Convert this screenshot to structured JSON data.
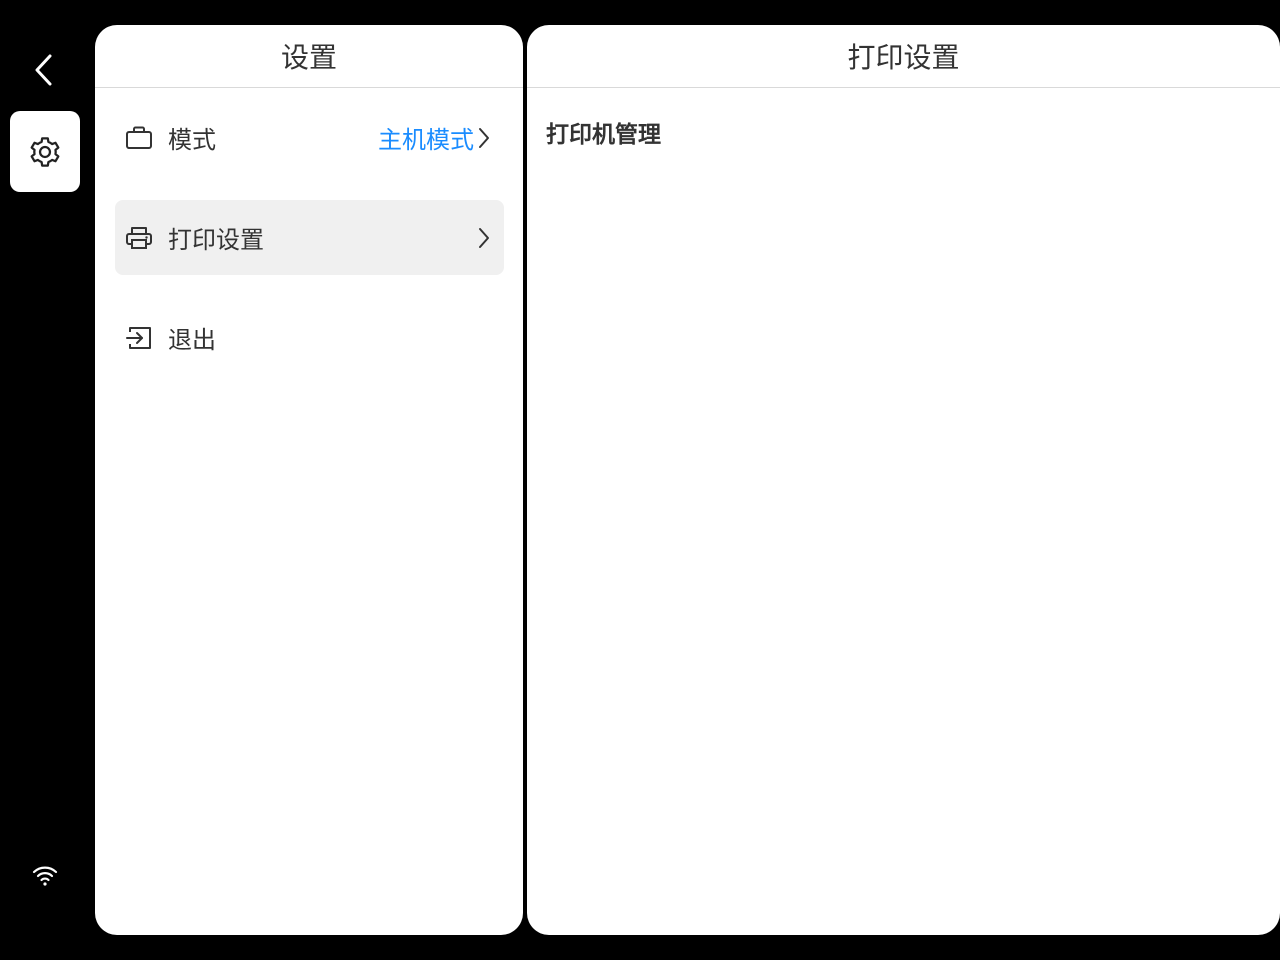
{
  "rail": {
    "back_icon": "chevron-left-icon",
    "settings_icon": "gear-icon",
    "wifi_icon": "wifi-icon"
  },
  "settings_panel": {
    "title": "设置",
    "items": [
      {
        "label": "模式",
        "value": "主机模式",
        "icon": "briefcase-icon"
      },
      {
        "label": "打印设置",
        "icon": "printer-icon",
        "selected": true
      },
      {
        "label": "退出",
        "icon": "exit-icon"
      }
    ]
  },
  "detail_panel": {
    "title": "打印设置",
    "section_title": "打印机管理"
  },
  "colors": {
    "background": "#000000",
    "panel": "#ffffff",
    "accent": "#1a8cff",
    "selected_row": "#f0f0f0",
    "text": "#333333"
  }
}
